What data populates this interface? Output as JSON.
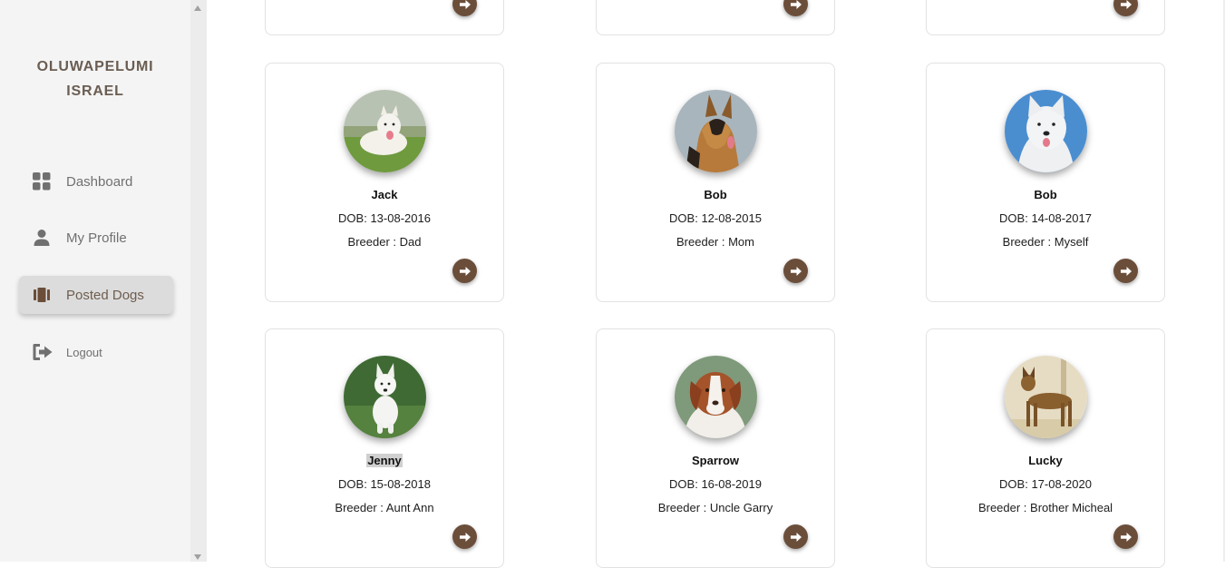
{
  "sidebar": {
    "user_name_line1": "OLUWAPELUMI",
    "user_name_line2": "ISRAEL",
    "nav": [
      {
        "label": "Dashboard",
        "icon": "grid-icon"
      },
      {
        "label": "My Profile",
        "icon": "person-icon"
      },
      {
        "label": "Posted Dogs",
        "icon": "book-icon",
        "active": true
      },
      {
        "label": "Logout",
        "icon": "logout-icon"
      }
    ]
  },
  "colors": {
    "accent_brown": "#6b4e3a",
    "active_nav_bg": "#dcdcdc",
    "sidebar_bg": "#f4f4f4"
  },
  "dogs": [
    {
      "name": "Jack",
      "dob": "DOB: 13-08-2016",
      "breeder": "Breeder : Dad"
    },
    {
      "name": "Bob",
      "dob": "DOB: 12-08-2015",
      "breeder": "Breeder : Mom"
    },
    {
      "name": "Bob",
      "dob": "DOB: 14-08-2017",
      "breeder": "Breeder : Myself"
    },
    {
      "name": "Jenny",
      "dob": "DOB: 15-08-2018",
      "breeder": "Breeder : Aunt Ann",
      "selected": true
    },
    {
      "name": "Sparrow",
      "dob": "DOB: 16-08-2019",
      "breeder": "Breeder : Uncle Garry"
    },
    {
      "name": "Lucky",
      "dob": "DOB: 17-08-2020",
      "breeder": "Breeder : Brother Micheal"
    }
  ]
}
